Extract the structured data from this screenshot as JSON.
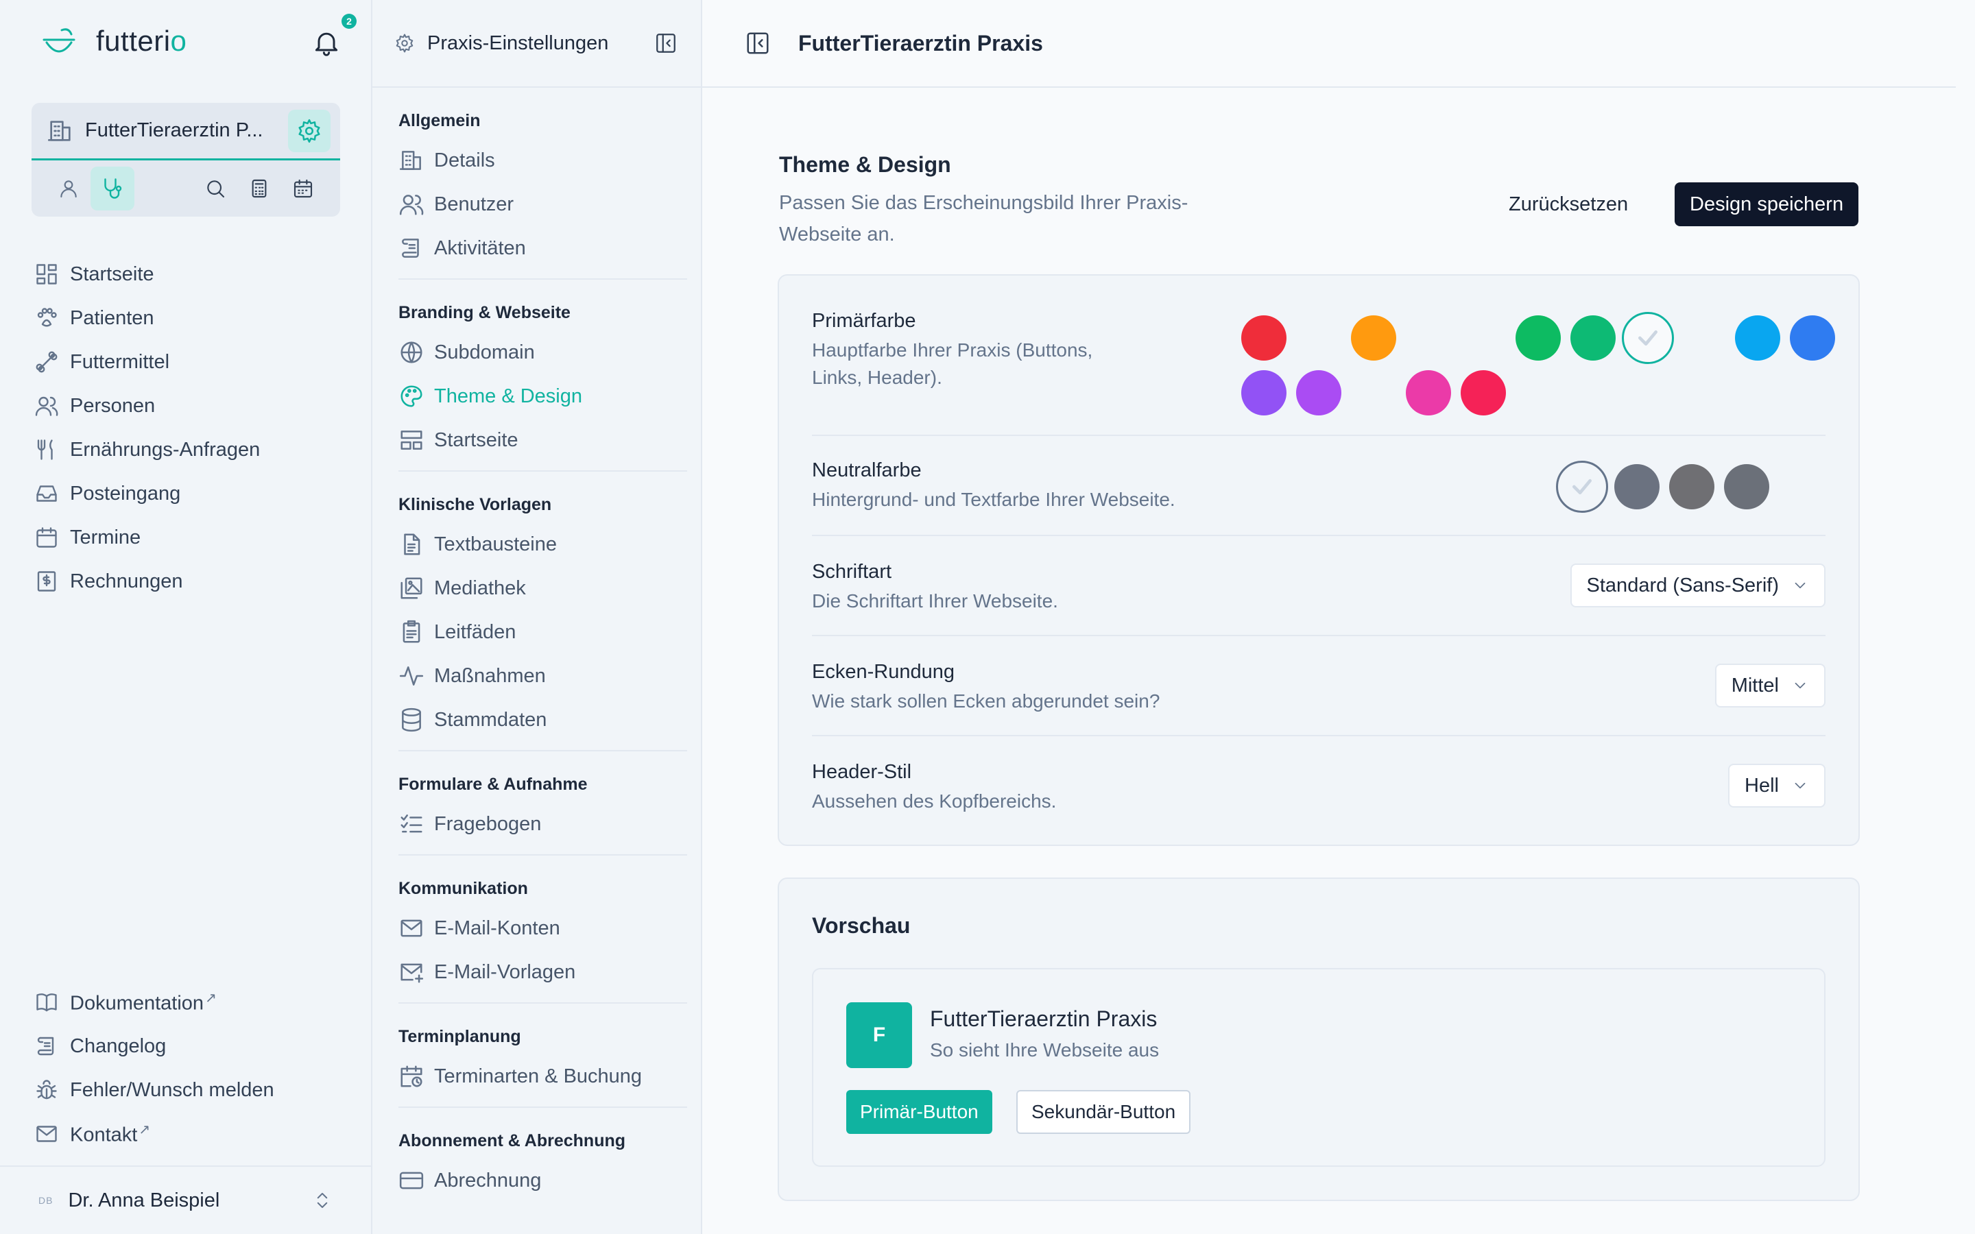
{
  "app": {
    "logo_text_a": "futteri",
    "logo_text_b": "o",
    "notifications": "2",
    "accent": "#10b3a0"
  },
  "practice": {
    "name": "FutterTieraerztin P..."
  },
  "nav": {
    "items": [
      {
        "label": "Startseite",
        "icon": "dashboard-icon"
      },
      {
        "label": "Patienten",
        "icon": "paw-icon"
      },
      {
        "label": "Futtermittel",
        "icon": "bone-icon"
      },
      {
        "label": "Personen",
        "icon": "users-icon"
      },
      {
        "label": "Ernährungs-Anfragen",
        "icon": "utensils-icon"
      },
      {
        "label": "Posteingang",
        "icon": "inbox-icon"
      },
      {
        "label": "Termine",
        "icon": "calendar-icon"
      },
      {
        "label": "Rechnungen",
        "icon": "invoice-icon"
      }
    ],
    "bottom": [
      {
        "label": "Dokumentation",
        "icon": "book-icon"
      },
      {
        "label": "Changelog",
        "icon": "scroll-icon"
      },
      {
        "label": "Fehler/Wunsch melden",
        "icon": "bug-icon"
      },
      {
        "label": "Kontakt",
        "icon": "mail-icon"
      }
    ],
    "external_mark": "↗"
  },
  "user": {
    "initials": "DB",
    "name": "Dr. Anna Beispiel"
  },
  "settings": {
    "title": "Praxis-Einstellungen",
    "groups": [
      {
        "label": "Allgemein",
        "items": [
          "Details",
          "Benutzer",
          "Aktivitäten"
        ]
      },
      {
        "label": "Branding & Webseite",
        "items": [
          "Subdomain",
          "Theme & Design",
          "Startseite"
        ]
      },
      {
        "label": "Klinische Vorlagen",
        "items": [
          "Textbausteine",
          "Mediathek",
          "Leitfäden",
          "Maßnahmen",
          "Stammdaten"
        ]
      },
      {
        "label": "Formulare & Aufnahme",
        "items": [
          "Fragebogen"
        ]
      },
      {
        "label": "Kommunikation",
        "items": [
          "E-Mail-Konten",
          "E-Mail-Vorlagen"
        ]
      },
      {
        "label": "Terminplanung",
        "items": [
          "Terminarten & Buchung"
        ]
      },
      {
        "label": "Abonnement & Abrechnung",
        "items": [
          "Abrechnung"
        ]
      }
    ],
    "active_item": "Theme & Design"
  },
  "main": {
    "title": "FutterTieraerztin Praxis",
    "section_title": "Theme & Design",
    "section_sub": "Passen Sie das Erscheinungsbild Ihrer Praxis-Webseite an.",
    "reset_label": "Zurücksetzen",
    "save_label": "Design speichern",
    "primary": {
      "label": "Primärfarbe",
      "desc": "Hauptfarbe Ihrer Praxis (Buttons, Links, Header)."
    },
    "neutral": {
      "label": "Neutralfarbe",
      "desc": "Hintergrund- und Textfarbe Ihrer Webseite."
    },
    "font": {
      "label": "Schriftart",
      "desc": "Die Schriftart Ihrer Webseite.",
      "value": "Standard (Sans-Serif)"
    },
    "corners": {
      "label": "Ecken-Rundung",
      "desc": "Wie stark sollen Ecken abgerundet sein?",
      "value": "Mittel"
    },
    "header": {
      "label": "Header-Stil",
      "desc": "Aussehen des Kopfbereichs.",
      "value": "Hell"
    }
  },
  "primary_colors": {
    "row1": [
      "#ef2d3a",
      "#ff9a0f",
      "#0dbb62",
      "#0dba74",
      "selected",
      "#09a6f0",
      "#2f7cf1"
    ],
    "row2": [
      "#9252f5",
      "#aa4cf3",
      "#eb3aa8",
      "#f52257"
    ]
  },
  "neutral_colors": [
    "selected",
    "#6b7280",
    "#6f6f73",
    "#6b7079"
  ],
  "preview": {
    "title": "Vorschau",
    "logo_letter": "F",
    "name": "FutterTieraerztin Praxis",
    "sub": "So sieht Ihre Webseite aus",
    "primary_btn": "Primär-Button",
    "secondary_btn": "Sekundär-Button"
  }
}
